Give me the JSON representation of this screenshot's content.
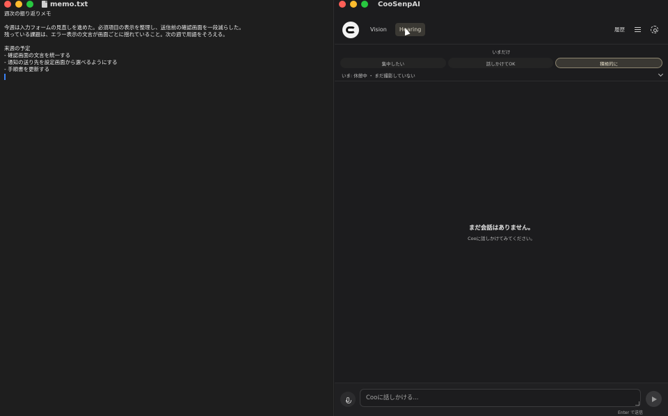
{
  "editor": {
    "filename": "memo.txt",
    "lines": [
      "週次の振り返りメモ",
      "",
      "今週は入力フォームの見直しを進めた。必須項目の表示を整理し、送信前の確認画面を一段減らした。",
      "残っている課題は、エラー表示の文言が画面ごとに揺れていること。次の週で用語をそろえる。",
      "",
      "来週の予定",
      "- 確認画面の文言を統一する",
      "- 通知の送り先を設定画面から選べるようにする",
      "- 手順書を更新する"
    ]
  },
  "app": {
    "title": "CooSenpAI",
    "tabs": [
      {
        "label": "Vision",
        "active": false
      },
      {
        "label": "Hearing",
        "active": true
      }
    ],
    "history_label": "履歴",
    "mode": {
      "caption": "いまだけ",
      "options": [
        {
          "label": "集中したい",
          "active": false
        },
        {
          "label": "話しかけてOK",
          "active": false
        },
        {
          "label": "積極的に",
          "active": true
        }
      ],
      "status": "いま: 休憩中 ・ まだ撮影していない"
    },
    "chat": {
      "empty_title": "まだ会話はありません。",
      "empty_sub": "Cooに話しかけてみてください。"
    },
    "composer": {
      "placeholder": "Cooに話しかける...",
      "value": "",
      "hint": "Enter で送信"
    }
  },
  "icons": {
    "mic": "mic-icon",
    "send": "send-icon",
    "settings": "gear-icon",
    "menu": "menu-icon",
    "expand": "chevron-down-icon"
  },
  "colors": {
    "background": "#1c1c1e",
    "accent": "#3a3833",
    "accent_border": "#8d8570",
    "caret": "#3b82f6"
  }
}
